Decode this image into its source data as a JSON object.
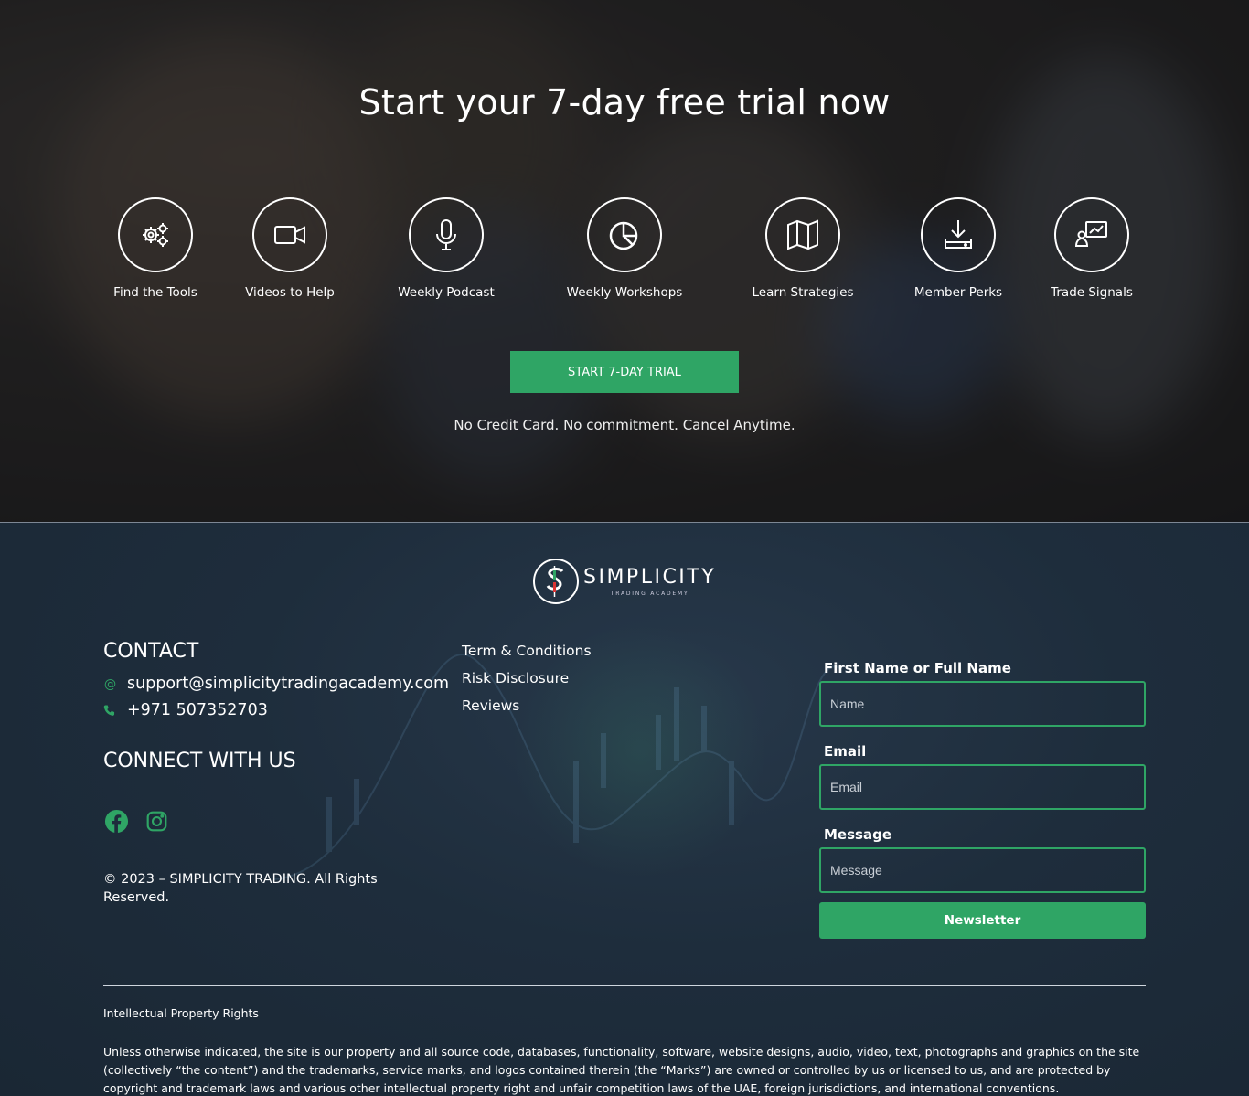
{
  "hero": {
    "title": "Start your 7-day free trial now",
    "features": [
      {
        "label": "Find the Tools",
        "icon": "gears-icon"
      },
      {
        "label": "Videos to Help",
        "icon": "video-camera-icon"
      },
      {
        "label": "Weekly Podcast",
        "icon": "microphone-icon"
      },
      {
        "label": "Weekly Workshops",
        "icon": "pie-chart-icon"
      },
      {
        "label": "Learn Strategies",
        "icon": "map-icon"
      },
      {
        "label": "Member Perks",
        "icon": "download-icon"
      },
      {
        "label": "Trade Signals",
        "icon": "presentation-chart-icon"
      }
    ],
    "cta_label": "START 7-DAY TRIAL",
    "subtext": "No Credit Card. No commitment. Cancel Anytime."
  },
  "footer": {
    "logo": {
      "name": "SIMPLICITY",
      "tagline": "TRADING ACADEMY"
    },
    "contact_heading": "CONTACT",
    "email": "support@simplicitytradingacademy.com",
    "phone": "+971 507352703",
    "connect_heading": "CONNECT WITH US",
    "copyright": "© 2023 – SIMPLICITY TRADING. All Rights Reserved.",
    "links": [
      "Term & Conditions",
      "Risk Disclosure",
      "Reviews"
    ],
    "form": {
      "name_label": "First Name or Full Name",
      "name_placeholder": "Name",
      "email_label": "Email",
      "email_placeholder": "Email",
      "message_label": "Message",
      "message_placeholder": "Message",
      "submit_label": "Newsletter"
    },
    "ip_title": "Intellectual Property Rights",
    "ip_text": "Unless otherwise indicated, the site is our property and all source code, databases, functionality, software, website designs, audio, video, text, photographs and graphics on the site (collectively “the content”) and the trademarks, service marks, and logos contained therein (the “Marks”) are owned or controlled by us or licensed to us, and are protected by copyright and trademark laws and various other intellectual property right and unfair competition laws of the UAE, foreign jurisdictions, and international conventions."
  },
  "colors": {
    "accent": "#2fa565",
    "footer_bg": "#1e2d3c"
  }
}
